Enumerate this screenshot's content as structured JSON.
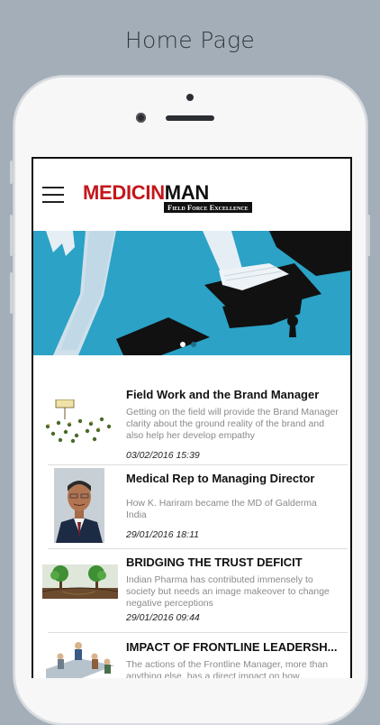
{
  "caption": "Home Page",
  "app": {
    "logo": {
      "text_red": "MEDICIN",
      "text_black": "MAN",
      "tagline": "Field Force Excellence"
    }
  },
  "carousel": {
    "slide_count": 2,
    "active_index": 0
  },
  "articles": [
    {
      "title": "Field Work and  the Brand Manager",
      "summary": "Getting on the field will provide the Brand Manager clarity about the ground reality of the brand and also help her develop empathy",
      "date": "03/02/2016 15:39",
      "thumb_icon": "field-markers-illustration"
    },
    {
      "title": "Medical Rep to Managing Director",
      "summary": "How K. Hariram became the MD of Galderma India",
      "date": "29/01/2016 18:11",
      "thumb_icon": "portrait-photo"
    },
    {
      "title": "BRIDGING THE TRUST DEFICIT",
      "summary": "Indian Pharma has contributed immensely to society but needs an image makeover to change negative perceptions",
      "date": "29/01/2016 09:44",
      "thumb_icon": "trees-bridge-illustration"
    },
    {
      "title": "IMPACT OF FRONTLINE LEADERSH...",
      "summary": "The actions of the Frontline Manager, more than anything else, has a direct impact on how",
      "date": "",
      "thumb_icon": "team-leader-illustration"
    }
  ],
  "colors": {
    "brand_red": "#c4161c",
    "banner_blue": "#2ba2c6"
  }
}
